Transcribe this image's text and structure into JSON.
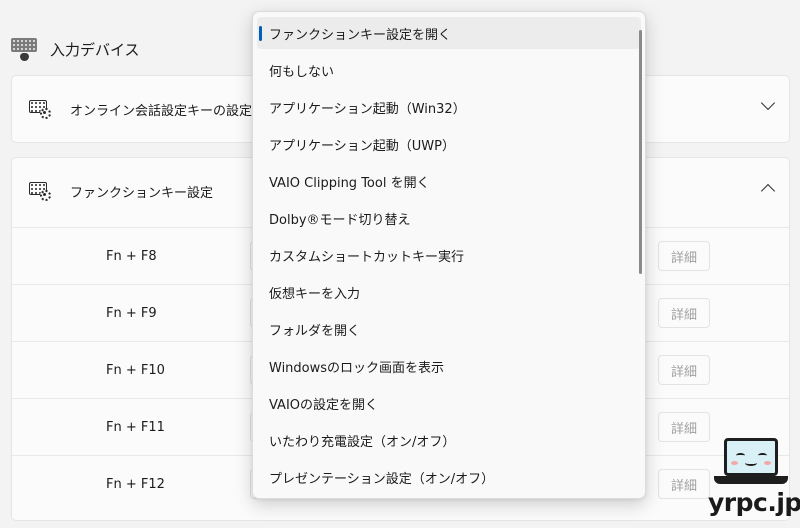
{
  "section": {
    "title": "入力デバイス",
    "icon": "keyboard-mouse-icon"
  },
  "cards": {
    "online_meeting": {
      "label": "オンライン会話設定キーの設定",
      "icon": "keyboard-gear-icon",
      "expanded": false
    },
    "function_keys": {
      "label": "ファンクションキー設定",
      "icon": "keyboard-gear-icon",
      "expanded": true,
      "rows": [
        {
          "key": "Fn + F8",
          "detail_label": "詳細"
        },
        {
          "key": "Fn + F9",
          "detail_label": "詳細"
        },
        {
          "key": "Fn + F10",
          "detail_label": "詳細"
        },
        {
          "key": "Fn + F11",
          "detail_label": "詳細"
        },
        {
          "key": "Fn + F12",
          "detail_label": "詳細"
        }
      ]
    }
  },
  "dropdown": {
    "selected_index": 0,
    "options": [
      "ファンクションキー設定を開く",
      "何もしない",
      "アプリケーション起動（Win32）",
      "アプリケーション起動（UWP）",
      "VAIO Clipping Tool を開く",
      "Dolby®モード切り替え",
      "カスタムショートカットキー実行",
      "仮想キーを入力",
      "フォルダを開く",
      "Windowsのロック画面を表示",
      "VAIOの設定を開く",
      "いたわり充電設定（オン/オフ）",
      "プレゼンテーション設定（オン/オフ）"
    ]
  },
  "watermark": {
    "text": "yrpc.jp"
  },
  "colors": {
    "accent": "#005fb8",
    "background": "#f3f3f3",
    "card": "#fbfbfb",
    "disabled_text": "#a0a0a0"
  }
}
